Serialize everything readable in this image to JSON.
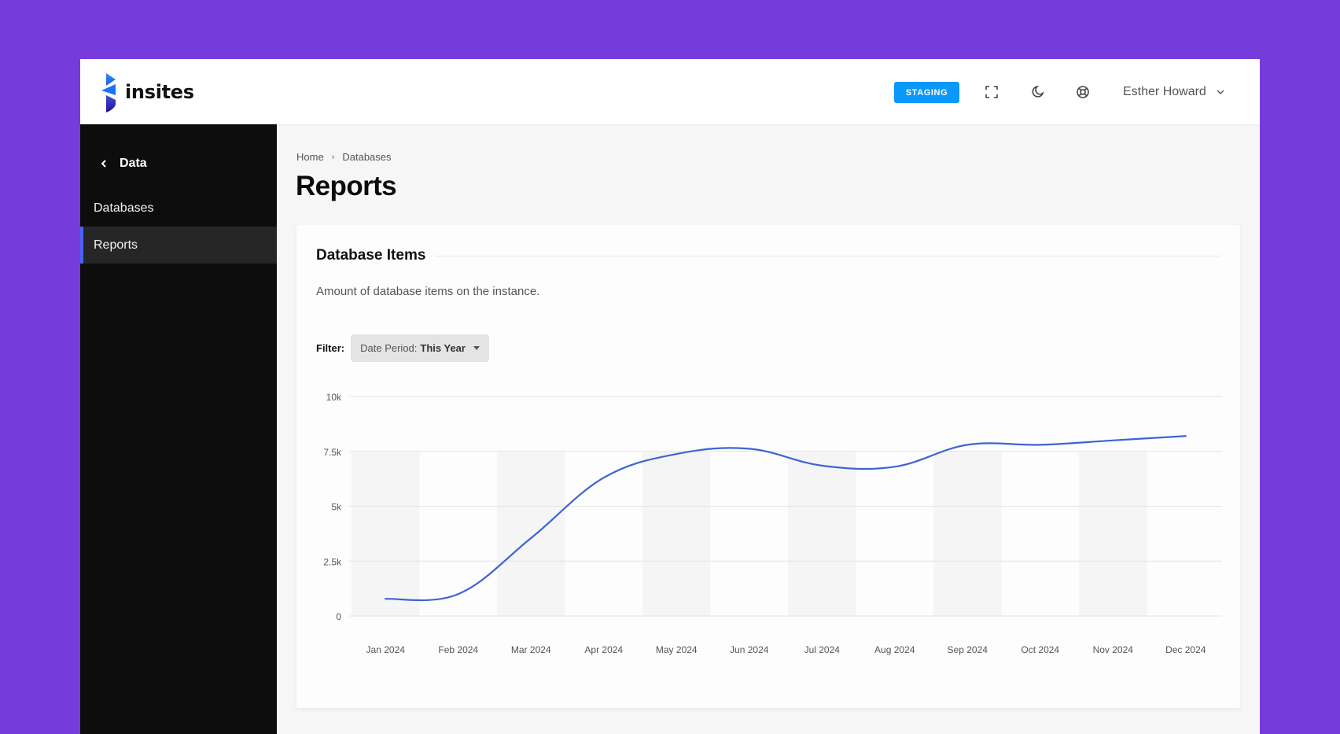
{
  "header": {
    "brand": "insites",
    "env_badge": "STAGING",
    "icons": [
      "fullscreen-icon",
      "moon-icon",
      "help-lifebuoy-icon"
    ],
    "user_name": "Esther Howard"
  },
  "sidebar": {
    "back_label": "Data",
    "items": [
      {
        "label": "Databases",
        "active": false
      },
      {
        "label": "Reports",
        "active": true
      }
    ]
  },
  "breadcrumb": [
    "Home",
    "Databases"
  ],
  "page_title": "Reports",
  "card": {
    "title": "Database Items",
    "description": "Amount of database items on the instance.",
    "filter_label": "Filter:",
    "filter_key": "Date Period:",
    "filter_value": "This Year"
  },
  "colors": {
    "background": "#763bdb",
    "accent": "#0a98fb",
    "sidebar_active": "#4a63f2",
    "line": "#3f63d4"
  },
  "chart_data": {
    "type": "line",
    "title": "Database Items",
    "xlabel": "",
    "ylabel": "",
    "categories": [
      "Jan 2024",
      "Feb 2024",
      "Mar 2024",
      "Apr 2024",
      "May 2024",
      "Jun 2024",
      "Jul 2024",
      "Aug 2024",
      "Sep 2024",
      "Oct 2024",
      "Nov 2024",
      "Dec 2024"
    ],
    "series": [
      {
        "name": "Database Items",
        "values": [
          780,
          1000,
          3550,
          6300,
          7380,
          7620,
          6850,
          6800,
          7800,
          7800,
          8000,
          8200
        ]
      }
    ],
    "ylim": [
      0,
      10000
    ],
    "yticks": [
      0,
      2500,
      5000,
      7500,
      10000
    ],
    "ytick_labels": [
      "0",
      "2.5k",
      "5k",
      "7.5k",
      "10k"
    ],
    "grid": true,
    "legend": "none"
  }
}
